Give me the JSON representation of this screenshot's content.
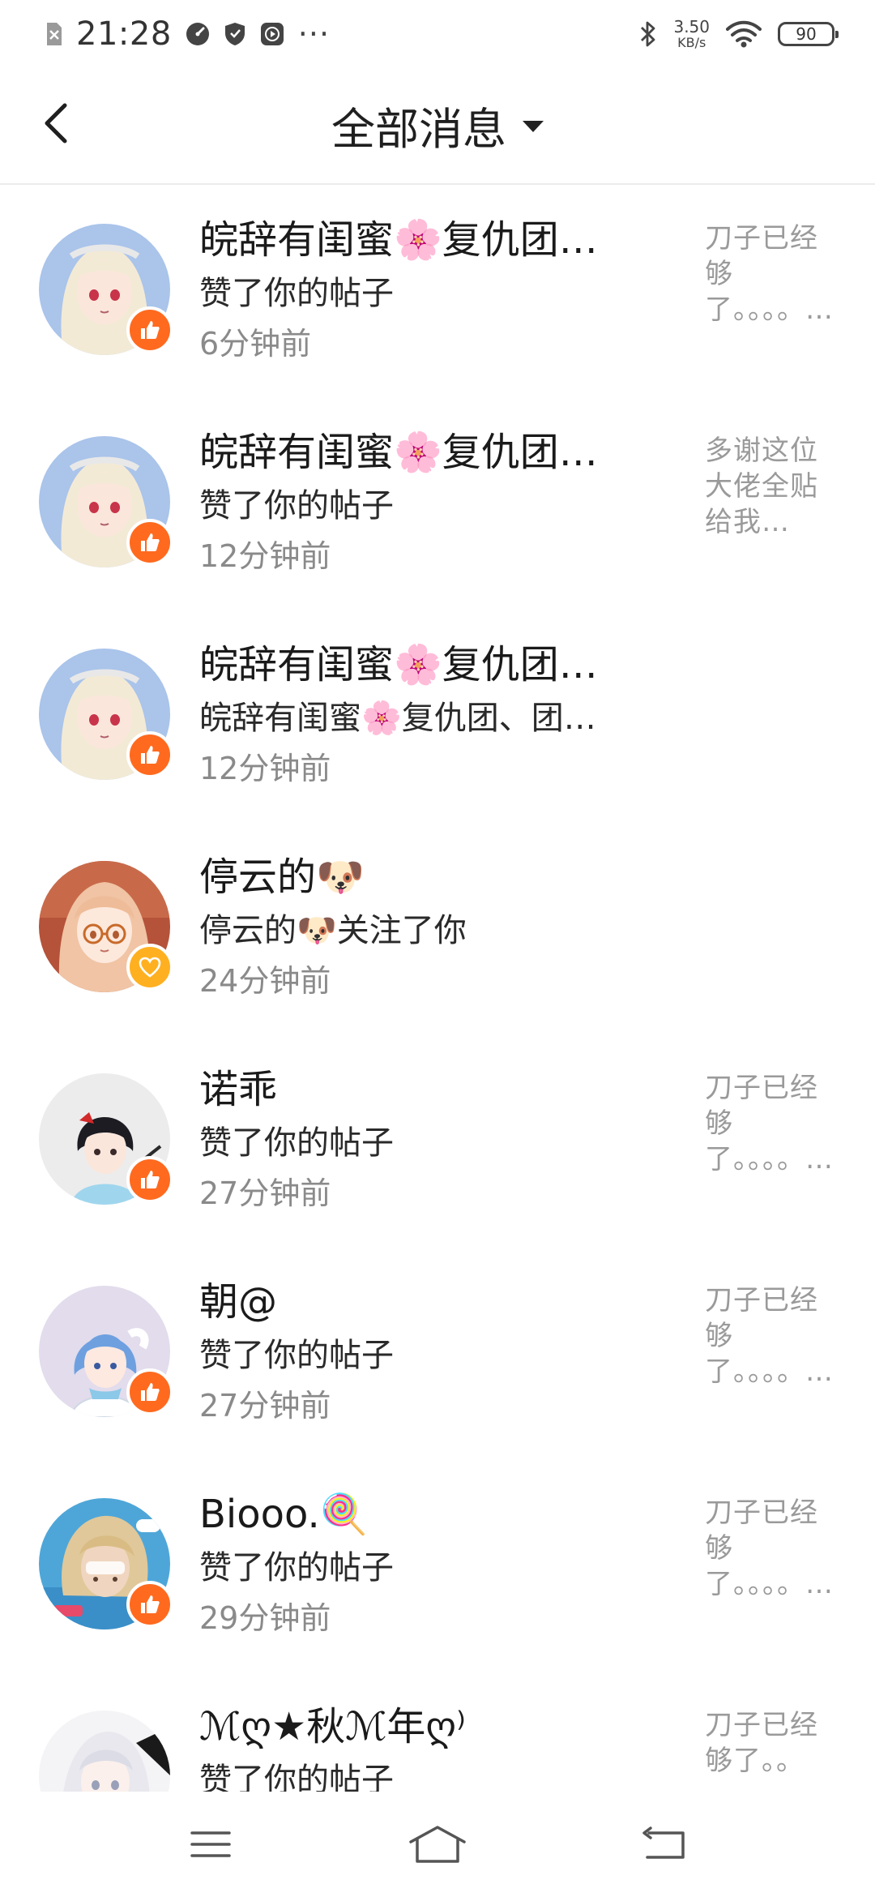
{
  "status_bar": {
    "time": "21:28",
    "net_speed_value": "3.50",
    "net_speed_unit": "KB/s",
    "battery": "90",
    "more": "···"
  },
  "header": {
    "title": "全部消息"
  },
  "messages": [
    {
      "name": "皖辞有闺蜜🌸复仇团…",
      "action": "赞了你的帖子",
      "time": "6分钟前",
      "preview": "刀子已经够了。。。。…",
      "badge": "like"
    },
    {
      "name": "皖辞有闺蜜🌸复仇团…",
      "action": "赞了你的帖子",
      "time": "12分钟前",
      "preview": "多谢这位大佬全贴给我…",
      "badge": "like"
    },
    {
      "name": "皖辞有闺蜜🌸复仇团…",
      "action": "皖辞有闺蜜🌸复仇团、团…",
      "time": "12分钟前",
      "preview": "",
      "badge": "like"
    },
    {
      "name": "停云的🐶",
      "action": "停云的🐶关注了你",
      "time": "24分钟前",
      "preview": "",
      "badge": "follow"
    },
    {
      "name": "诺乖",
      "action": "赞了你的帖子",
      "time": "27分钟前",
      "preview": "刀子已经够了。。。。…",
      "badge": "like"
    },
    {
      "name": "朝@",
      "action": "赞了你的帖子",
      "time": "27分钟前",
      "preview": "刀子已经够了。。。。…",
      "badge": "like"
    },
    {
      "name": "Biooo.🍭",
      "action": "赞了你的帖子",
      "time": "29分钟前",
      "preview": "刀子已经够了。。。。…",
      "badge": "like"
    },
    {
      "name": "ℳღ★秋ℳ年ღ⁾",
      "action": "赞了你的帖子",
      "time": "",
      "preview": "刀子已经够了。。",
      "badge": "like"
    }
  ],
  "colors": {
    "like_badge": "#ff6a1f",
    "follow_badge": "#ffb020",
    "muted_text": "#8a8a8a",
    "preview_text": "#9a9a9a"
  }
}
